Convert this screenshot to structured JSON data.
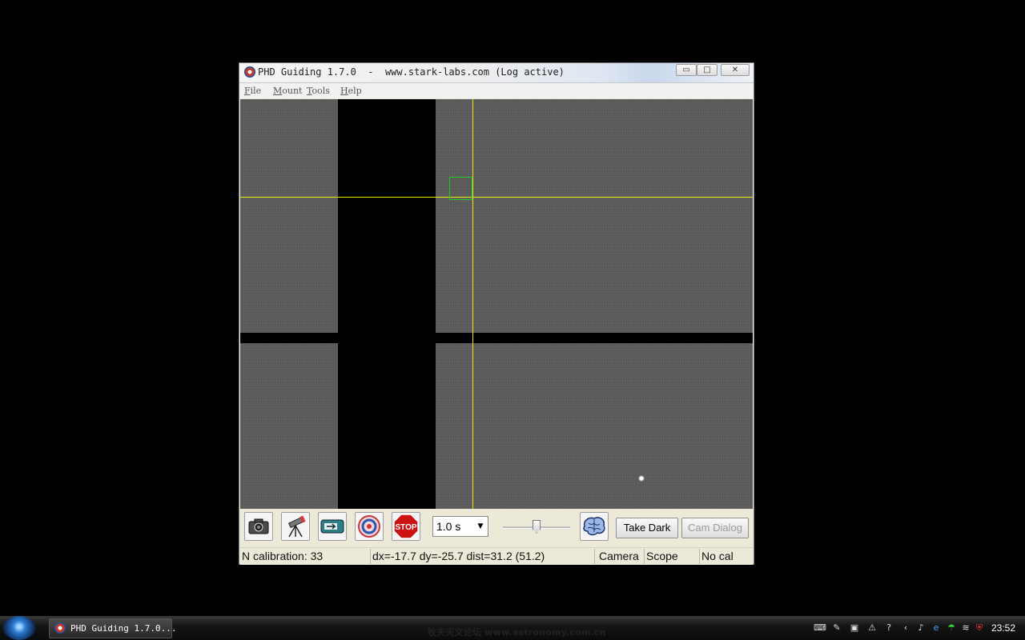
{
  "window": {
    "title": "PHD Guiding 1.7.0  -  www.stark-labs.com (Log active)",
    "controls": {
      "minimize": "▭",
      "maximize": "□",
      "close": "✕"
    }
  },
  "menu": [
    "File",
    "Mount",
    "Tools",
    "Help"
  ],
  "toolbar": {
    "buttons": [
      {
        "name": "loop-exposure-button",
        "icon": "camera-icon"
      },
      {
        "name": "connect-telescope-button",
        "icon": "telescope-icon"
      },
      {
        "name": "connect-camera-button",
        "icon": "camera-connect-icon"
      },
      {
        "name": "phd-guide-button",
        "icon": "phd-logo-icon"
      },
      {
        "name": "stop-button",
        "icon": "stop-icon",
        "label": "STOP"
      }
    ],
    "exposure": {
      "value": "1.0 s",
      "arrow": "▼"
    },
    "gamma_slider_level": 0.5,
    "brain_icon": "brain-icon",
    "take_dark_label": "Take Dark",
    "cam_dialog_label": "Cam Dialog"
  },
  "status": {
    "message": "N calibration: 33",
    "offset": "dx=-17.7 dy=-25.7 dist=31.2 (51.2)",
    "camera": "Camera",
    "scope": "Scope",
    "cal": "No cal"
  },
  "taskbar": {
    "task_label": "PHD Guiding 1.7.0...",
    "watermark": "牧夫天文论坛 www.astronomy.com.cn",
    "tray_icons": [
      "keyboard-icon",
      "pen-icon",
      "display-icon",
      "network-icon",
      "help-icon",
      "chevron-left-icon",
      "volume-icon",
      "ie-icon",
      "umbrella-icon",
      "wifi-icon",
      "shield-icon"
    ],
    "clock": "23:52"
  },
  "colors": {
    "crosshair": "#e8e800",
    "selection_box": "#22cc22",
    "stop_red": "#cc1111"
  }
}
